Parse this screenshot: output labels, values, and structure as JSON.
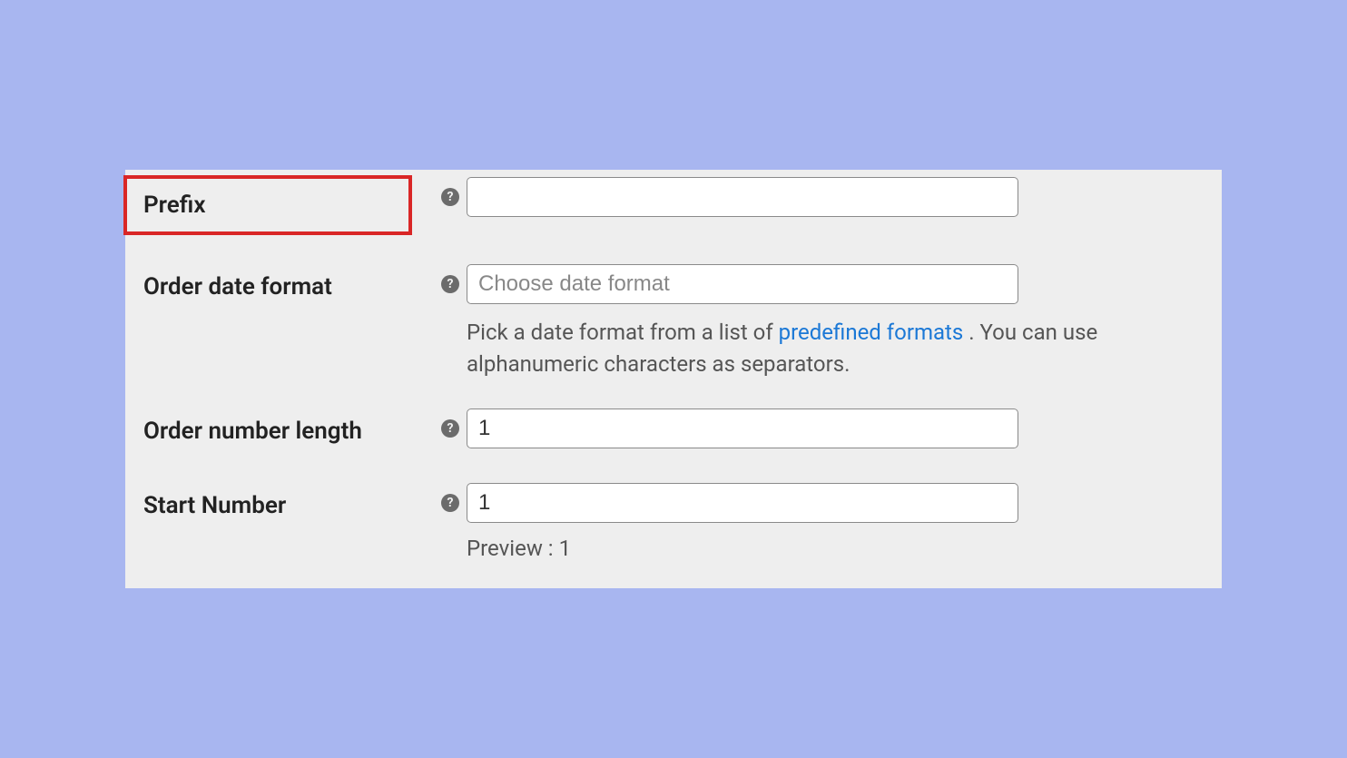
{
  "fields": {
    "prefix": {
      "label": "Prefix",
      "value": "",
      "placeholder": ""
    },
    "orderDateFormat": {
      "label": "Order date format",
      "value": "",
      "placeholder": "Choose date format",
      "helpTextBefore": "Pick a date format from a list of ",
      "helpLinkText": "predefined formats",
      "helpTextAfter": " . You can use alphanumeric characters as separators."
    },
    "orderNumberLength": {
      "label": "Order number length",
      "value": "1"
    },
    "startNumber": {
      "label": "Start Number",
      "value": "1",
      "previewLabel": "Preview : 1"
    }
  },
  "helpIconGlyph": "?"
}
